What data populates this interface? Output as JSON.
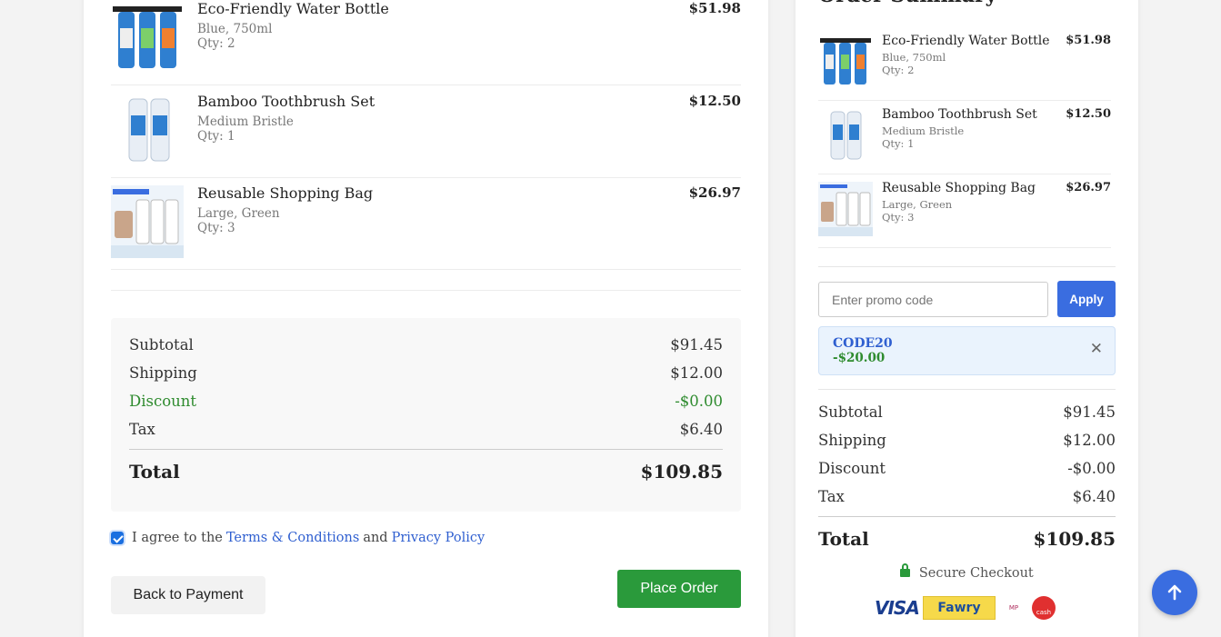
{
  "cart_items": [
    {
      "name": "Eco-Friendly Water Bottle",
      "variant": "Blue, 750ml",
      "qty": "Qty: 2",
      "price": "$51.98",
      "thumb": "water-filter-triple-image"
    },
    {
      "name": "Bamboo Toothbrush Set",
      "variant": "Medium Bristle",
      "qty": "Qty: 1",
      "price": "$12.50",
      "thumb": "filter-cartridges-image"
    },
    {
      "name": "Reusable Shopping Bag",
      "variant": "Large, Green",
      "qty": "Qty: 3",
      "price": "$26.97",
      "thumb": "five-stage-filter-image"
    }
  ],
  "totals": {
    "subtotal_label": "Subtotal",
    "subtotal": "$91.45",
    "shipping_label": "Shipping",
    "shipping": "$12.00",
    "discount_label": "Discount",
    "discount": "-$0.00",
    "tax_label": "Tax",
    "tax": "$6.40",
    "total_label": "Total",
    "total": "$109.85"
  },
  "agreement": {
    "prefix": "I agree to the",
    "terms_link": "Terms & Conditions",
    "middle": "and",
    "privacy_link": "Privacy Policy",
    "checked": true
  },
  "actions": {
    "back_label": "Back to Payment",
    "place_label": "Place Order"
  },
  "summary": {
    "title": "Order Summary",
    "items": [
      {
        "name": "Eco-Friendly Water Bottle",
        "variant": "Blue, 750ml",
        "qty": "Qty: 2",
        "price": "$51.98"
      },
      {
        "name": "Bamboo Toothbrush Set",
        "variant": "Medium Bristle",
        "qty": "Qty: 1",
        "price": "$12.50"
      },
      {
        "name": "Reusable Shopping Bag",
        "variant": "Large, Green",
        "qty": "Qty: 3",
        "price": "$26.97"
      }
    ],
    "promo": {
      "placeholder": "Enter promo code",
      "apply_label": "Apply",
      "applied_code": "CODE20",
      "applied_amount": "-$20.00"
    },
    "totals": {
      "subtotal_label": "Subtotal",
      "subtotal": "$91.45",
      "shipping_label": "Shipping",
      "shipping": "$12.00",
      "discount_label": "Discount",
      "discount": "-$0.00",
      "tax_label": "Tax",
      "tax": "$6.40",
      "total_label": "Total",
      "total": "$109.85"
    },
    "secure_label": "Secure Checkout",
    "payment_methods": [
      "VISA",
      "Fawry",
      "MP",
      "cash"
    ]
  },
  "colors": {
    "accent_blue": "#3a6de0",
    "success_green": "#2a9a3b",
    "link_blue": "#2f5fd0",
    "discount_green": "#2e8b2e"
  }
}
